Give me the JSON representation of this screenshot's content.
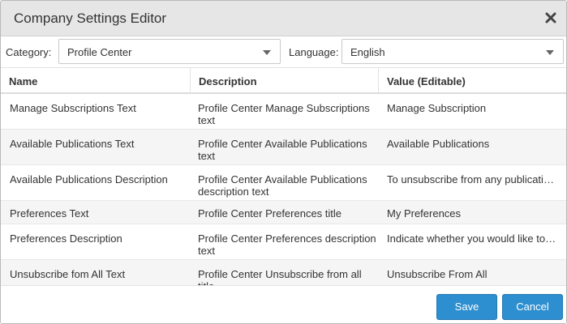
{
  "dialog": {
    "title": "Company Settings Editor"
  },
  "filters": {
    "category_label": "Category:",
    "category_value": "Profile Center",
    "language_label": "Language:",
    "language_value": "English"
  },
  "table": {
    "columns": [
      "Name",
      "Description",
      "Value (Editable)"
    ],
    "rows": [
      {
        "name": "Manage Subscriptions Text",
        "description": "Profile Center Manage Subscriptions text",
        "value": "Manage Subscription"
      },
      {
        "name": "Available Publications Text",
        "description": "Profile Center Available Publications text",
        "value": "Available Publications"
      },
      {
        "name": "Available Publications Description",
        "description": "Profile Center Available Publications description text",
        "value": "To unsubscribe from any publications"
      },
      {
        "name": "Preferences Text",
        "description": "Profile Center Preferences title",
        "value": "My Preferences"
      },
      {
        "name": "Preferences Description",
        "description": "Profile Center Preferences description text",
        "value": "Indicate whether you would like to receive"
      },
      {
        "name": "Unsubscribe fom All Text",
        "description": "Profile Center Unsubscribe from all title",
        "value": "Unsubscribe From All"
      }
    ]
  },
  "footer": {
    "save_label": "Save",
    "cancel_label": "Cancel"
  },
  "colors": {
    "primary_button": "#2d8fcf",
    "titlebar": "#e6e6e6",
    "row_alt": "#f5f5f5"
  },
  "icons": {
    "close": "close-icon",
    "dropdown": "chevron-down-icon"
  }
}
